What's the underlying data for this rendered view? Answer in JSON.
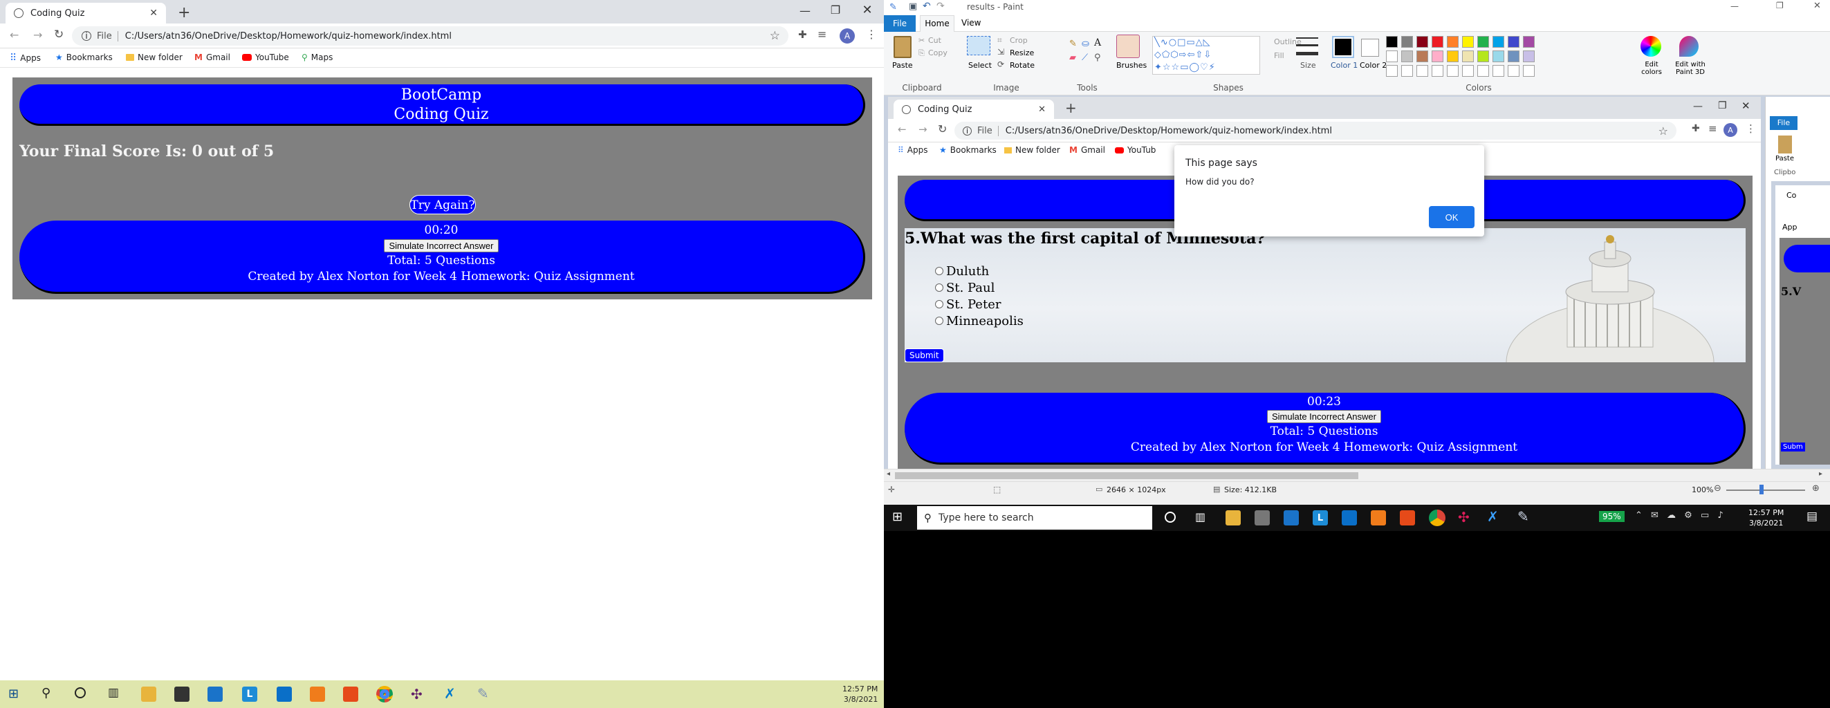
{
  "left_browser": {
    "tab_title": "Coding Quiz",
    "url_scheme": "File",
    "url": "C:/Users/atn36/OneDrive/Desktop/Homework/quiz-homework/index.html",
    "profile_initial": "A",
    "bookmarks": [
      "Apps",
      "Bookmarks",
      "New folder",
      "Gmail",
      "YouTube",
      "Maps"
    ],
    "page": {
      "header_line1": "BootCamp",
      "header_line2": "Coding Quiz",
      "final_score": "Your Final Score Is: 0 out of 5",
      "try_again": "Try Again?",
      "timer": "00:20",
      "simulate_button": "Simulate Incorrect Answer",
      "total": "Total: 5 Questions",
      "credit": "Created by Alex Norton for Week 4 Homework: Quiz Assignment"
    }
  },
  "left_taskbar": {
    "time": "12:57 PM",
    "date": "3/8/2021"
  },
  "paint": {
    "title": "results - Paint",
    "menu": [
      "File",
      "Home",
      "View"
    ],
    "clipboard": {
      "paste": "Paste",
      "cut": "Cut",
      "copy": "Copy",
      "label": "Clipboard"
    },
    "image": {
      "select": "Select",
      "crop": "Crop",
      "resize": "Resize",
      "rotate": "Rotate",
      "label": "Image"
    },
    "tools_label": "Tools",
    "brushes": "Brushes",
    "shapes": {
      "outline": "Outline",
      "fill": "Fill",
      "label": "Shapes"
    },
    "size": "Size",
    "color1": "Color 1",
    "color2": "Color 2",
    "colors_label": "Colors",
    "edit_colors": "Edit colors",
    "paint3d": "Edit with Paint 3D",
    "status_dims": "2646 × 1024px",
    "status_size": "Size: 412.1KB",
    "zoom": "100%",
    "palette": [
      "#000000",
      "#7f7f7f",
      "#880015",
      "#ed1c24",
      "#ff7f27",
      "#fff200",
      "#22b14c",
      "#00a2e8",
      "#3f48cc",
      "#a349a4",
      "#ffffff",
      "#c3c3c3",
      "#b97a57",
      "#ffaec9",
      "#ffc90e",
      "#efe4b0",
      "#b5e61d",
      "#99d9ea",
      "#7092be",
      "#c8bfe7"
    ]
  },
  "inner_browser": {
    "tab_title": "Coding Quiz",
    "url_scheme": "File",
    "url": "C:/Users/atn36/OneDrive/Desktop/Homework/quiz-homework/index.html",
    "profile_initial": "A",
    "bookmarks": [
      "Apps",
      "Bookmarks",
      "New folder",
      "Gmail",
      "YouTub"
    ],
    "alert": {
      "title": "This page says",
      "message": "How did you do?",
      "ok": "OK"
    },
    "question": "5.What was the first capital of Minnesota?",
    "answers": [
      "Duluth",
      "St. Paul",
      "St. Peter",
      "Minneapolis"
    ],
    "submit": "Submit",
    "timer": "00:23",
    "simulate_button": "Simulate Incorrect Answer",
    "total": "Total: 5 Questions",
    "credit": "Created by Alex Norton for Week 4 Homework: Quiz Assignment"
  },
  "third_window": {
    "menu_file": "File",
    "paste": "Paste",
    "clip": "Clipbo",
    "tab": "Co",
    "apps": "App",
    "question_stub": "5.V",
    "submit_stub": "Subm"
  },
  "inner_taskbar": {
    "search_placeholder": "Type here to search",
    "battery": "95%",
    "time": "12:57 PM",
    "date": "3/8/2021"
  }
}
